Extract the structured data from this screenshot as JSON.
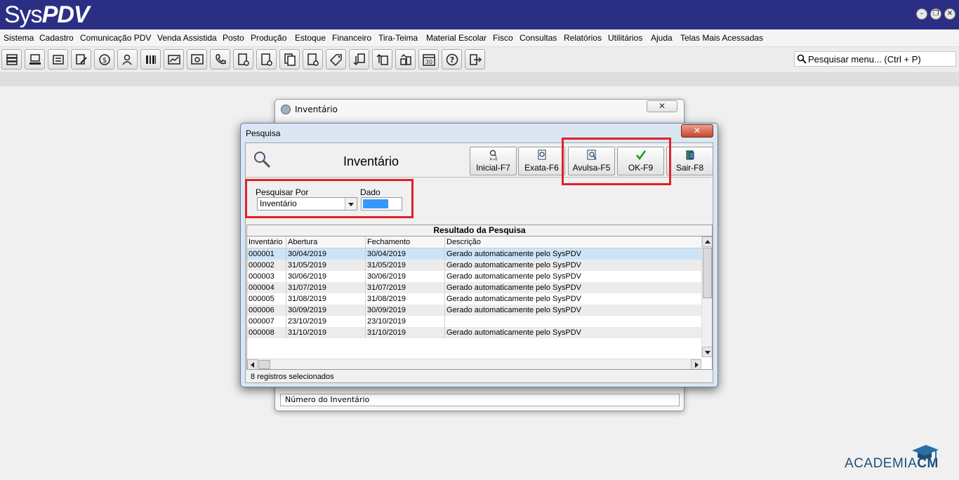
{
  "app": {
    "logo_a": "Sys",
    "logo_b": "PDV"
  },
  "window_controls": [
    "–",
    "❐",
    "✕"
  ],
  "menu": [
    "Sistema",
    "Cadastro",
    "Comunicação PDV",
    "Venda Assistida",
    "Posto",
    "Produção",
    "Estoque",
    "Financeiro",
    "Tira-Teima",
    "Material Escolar",
    "Fisco",
    "Consultas",
    "Relatórios",
    "Utilitários",
    "Ajuda",
    "Telas Mais Acessadas"
  ],
  "search": {
    "placeholder": "Pesquisar menu... (Ctrl + P)"
  },
  "back_window": {
    "title": "Inventário",
    "close": "✕",
    "status": "Número do Inventário"
  },
  "dialog": {
    "title": "Pesquisa",
    "close": "✕",
    "heading": "Inventário",
    "buttons": {
      "inicial": "Inicial-F7",
      "exata": "Exata-F6",
      "avulsa": "Avulsa-F5",
      "ok": "OK-F9",
      "sair": "Sair-F8"
    },
    "pesquisar_por_label": "Pesquisar Por",
    "pesquisar_por_value": "Inventário",
    "dado_label": "Dado",
    "grid_title": "Resultado da Pesquisa",
    "columns": [
      "Inventário",
      "Abertura",
      "Fechamento",
      "Descrição"
    ],
    "rows": [
      [
        "000001",
        "30/04/2019",
        "30/04/2019",
        "Gerado automaticamente pelo SysPDV"
      ],
      [
        "000002",
        "31/05/2019",
        "31/05/2019",
        "Gerado automaticamente pelo SysPDV"
      ],
      [
        "000003",
        "30/06/2019",
        "30/06/2019",
        "Gerado automaticamente pelo SysPDV"
      ],
      [
        "000004",
        "31/07/2019",
        "31/07/2019",
        "Gerado automaticamente pelo SysPDV"
      ],
      [
        "000005",
        "31/08/2019",
        "31/08/2019",
        "Gerado automaticamente pelo SysPDV"
      ],
      [
        "000006",
        "30/09/2019",
        "30/09/2019",
        "Gerado automaticamente pelo SysPDV"
      ],
      [
        "000007",
        "23/10/2019",
        "23/10/2019",
        ""
      ],
      [
        "000008",
        "31/10/2019",
        "31/10/2019",
        "Gerado automaticamente pelo SysPDV"
      ]
    ],
    "selected_row": 0,
    "status": "8 registros selecionados"
  },
  "watermark": {
    "a": "ACADEMIA",
    "b": "CM"
  },
  "colors": {
    "title_bar": "#2b2f84",
    "highlight": "#e0202a",
    "selection": "#cce4f7"
  }
}
